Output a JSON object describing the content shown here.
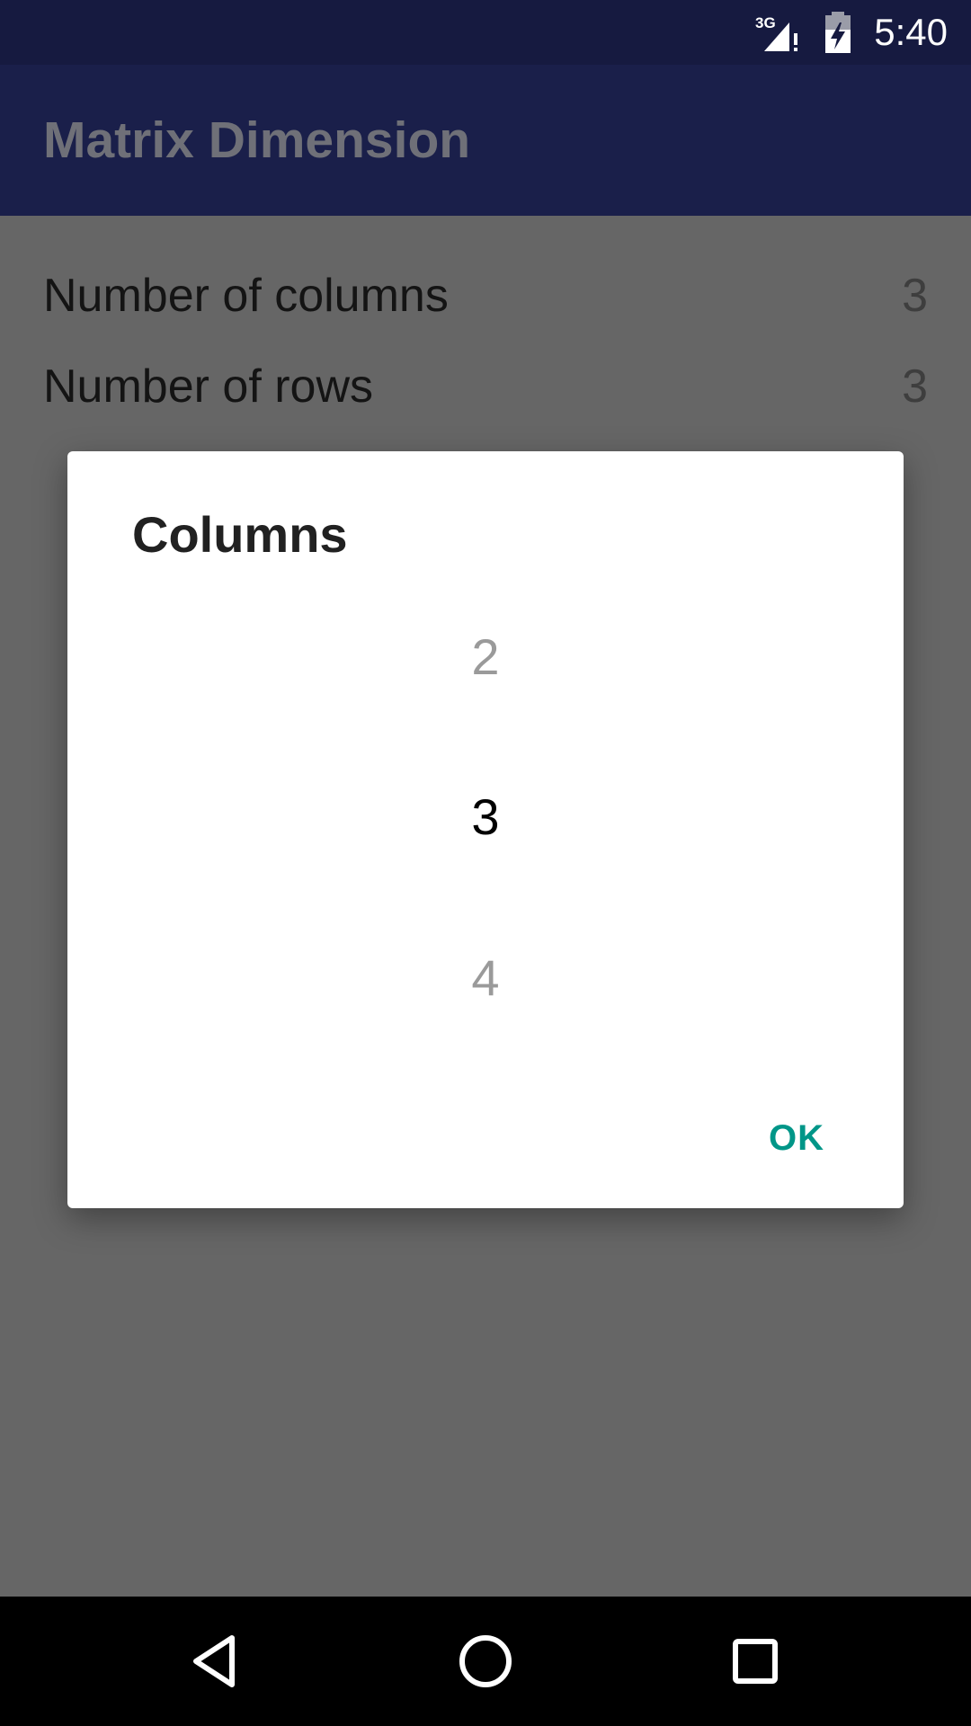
{
  "status_bar": {
    "network": "3G",
    "time": "5:40",
    "icons": [
      "signal-3g-icon",
      "battery-charging-icon"
    ]
  },
  "app_bar": {
    "title": "Matrix Dimension"
  },
  "preferences": [
    {
      "label": "Number of columns",
      "value": "3"
    },
    {
      "label": "Number of rows",
      "value": "3"
    }
  ],
  "dialog": {
    "title": "Columns",
    "picker": {
      "previous": "2",
      "selected": "3",
      "next": "4"
    },
    "ok_label": "OK",
    "accent_color": "#009688"
  },
  "nav_bar": {
    "icons": [
      "back-icon",
      "home-icon",
      "recents-icon"
    ]
  }
}
